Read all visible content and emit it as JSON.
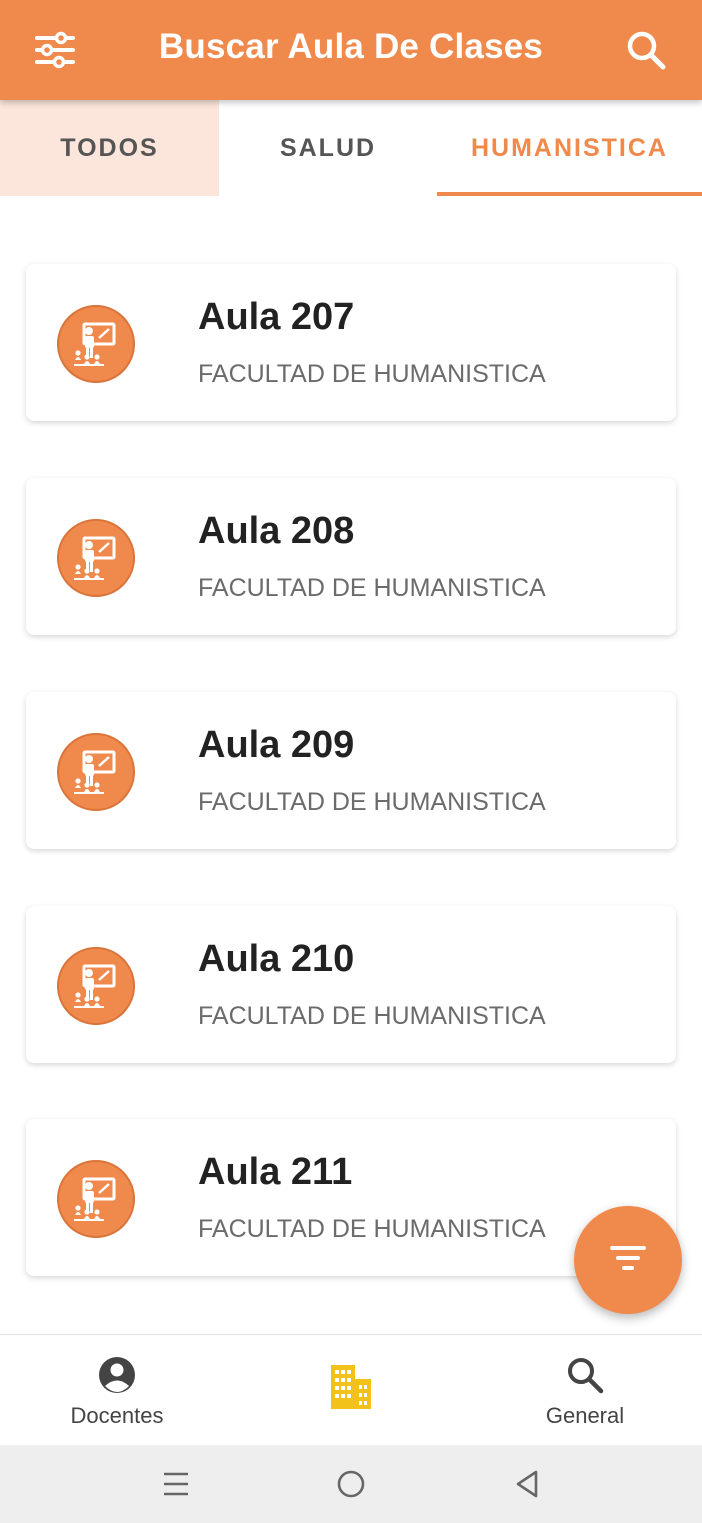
{
  "app_bar": {
    "title": "Buscar Aula De Clases",
    "left_icon": "sliders-icon",
    "right_icon": "search-icon",
    "background_color": "#EF894C"
  },
  "tabs": [
    {
      "label": "TODOS",
      "selected": false
    },
    {
      "label": "SALUD",
      "selected": false
    },
    {
      "label": "HUMANISTICA",
      "selected": true
    }
  ],
  "classrooms": [
    {
      "name": "Aula 207",
      "faculty": "FACULTAD DE HUMANISTICA",
      "icon": "teacher-board-icon"
    },
    {
      "name": "Aula 208",
      "faculty": "FACULTAD DE HUMANISTICA",
      "icon": "teacher-board-icon"
    },
    {
      "name": "Aula 209",
      "faculty": "FACULTAD DE HUMANISTICA",
      "icon": "teacher-board-icon"
    },
    {
      "name": "Aula 210",
      "faculty": "FACULTAD DE HUMANISTICA",
      "icon": "teacher-board-icon"
    },
    {
      "name": "Aula 211",
      "faculty": "FACULTAD DE HUMANISTICA",
      "icon": "teacher-board-icon"
    }
  ],
  "fab": {
    "icon": "filter-icon"
  },
  "bottom_nav": [
    {
      "label": "Docentes",
      "icon": "account-circle-icon",
      "active": false
    },
    {
      "label": "",
      "icon": "buildings-icon",
      "active": true
    },
    {
      "label": "General",
      "icon": "search-icon",
      "active": false
    }
  ],
  "system_nav": {
    "icons": [
      "recents-icon",
      "home-icon",
      "back-icon"
    ]
  },
  "colors": {
    "accent": "#EF894C",
    "selected_tab_bg": "#FCE6DB",
    "active_nav_icon": "#F2C21B"
  }
}
